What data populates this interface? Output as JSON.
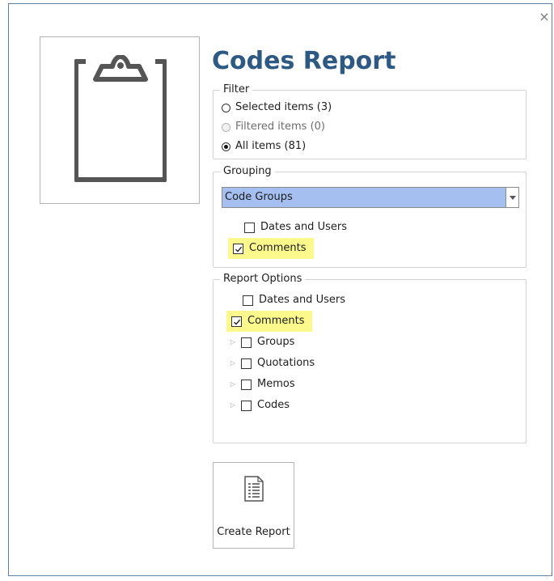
{
  "dialog": {
    "title": "Codes Report",
    "close_glyph": "×"
  },
  "filter": {
    "legend": "Filter",
    "options": [
      {
        "label": "Selected items (3)",
        "checked": false,
        "enabled": true
      },
      {
        "label": "Filtered items (0)",
        "checked": false,
        "enabled": false
      },
      {
        "label": "All items (81)",
        "checked": true,
        "enabled": true
      }
    ]
  },
  "grouping": {
    "legend": "Grouping",
    "selected": "Code Groups",
    "options": [
      {
        "label": "Dates and Users",
        "checked": false
      },
      {
        "label": "Comments",
        "checked": true,
        "highlighted": true
      }
    ]
  },
  "report_options": {
    "legend": "Report Options",
    "items": [
      {
        "label": "Dates and Users",
        "checked": false,
        "expandable": false
      },
      {
        "label": "Comments",
        "checked": true,
        "expandable": false,
        "highlighted": true
      },
      {
        "label": "Groups",
        "checked": false,
        "expandable": true
      },
      {
        "label": "Quotations",
        "checked": false,
        "expandable": true
      },
      {
        "label": "Memos",
        "checked": false,
        "expandable": true
      },
      {
        "label": "Codes",
        "checked": false,
        "expandable": true
      }
    ]
  },
  "actions": {
    "create_report_label": "Create Report"
  },
  "icons": {
    "thumbnail": "clipboard-icon",
    "create_report": "document-report-icon"
  },
  "colors": {
    "title": "#2c5a85",
    "highlight": "#fbf98b",
    "selected_dropdown": "#a4bff0"
  }
}
